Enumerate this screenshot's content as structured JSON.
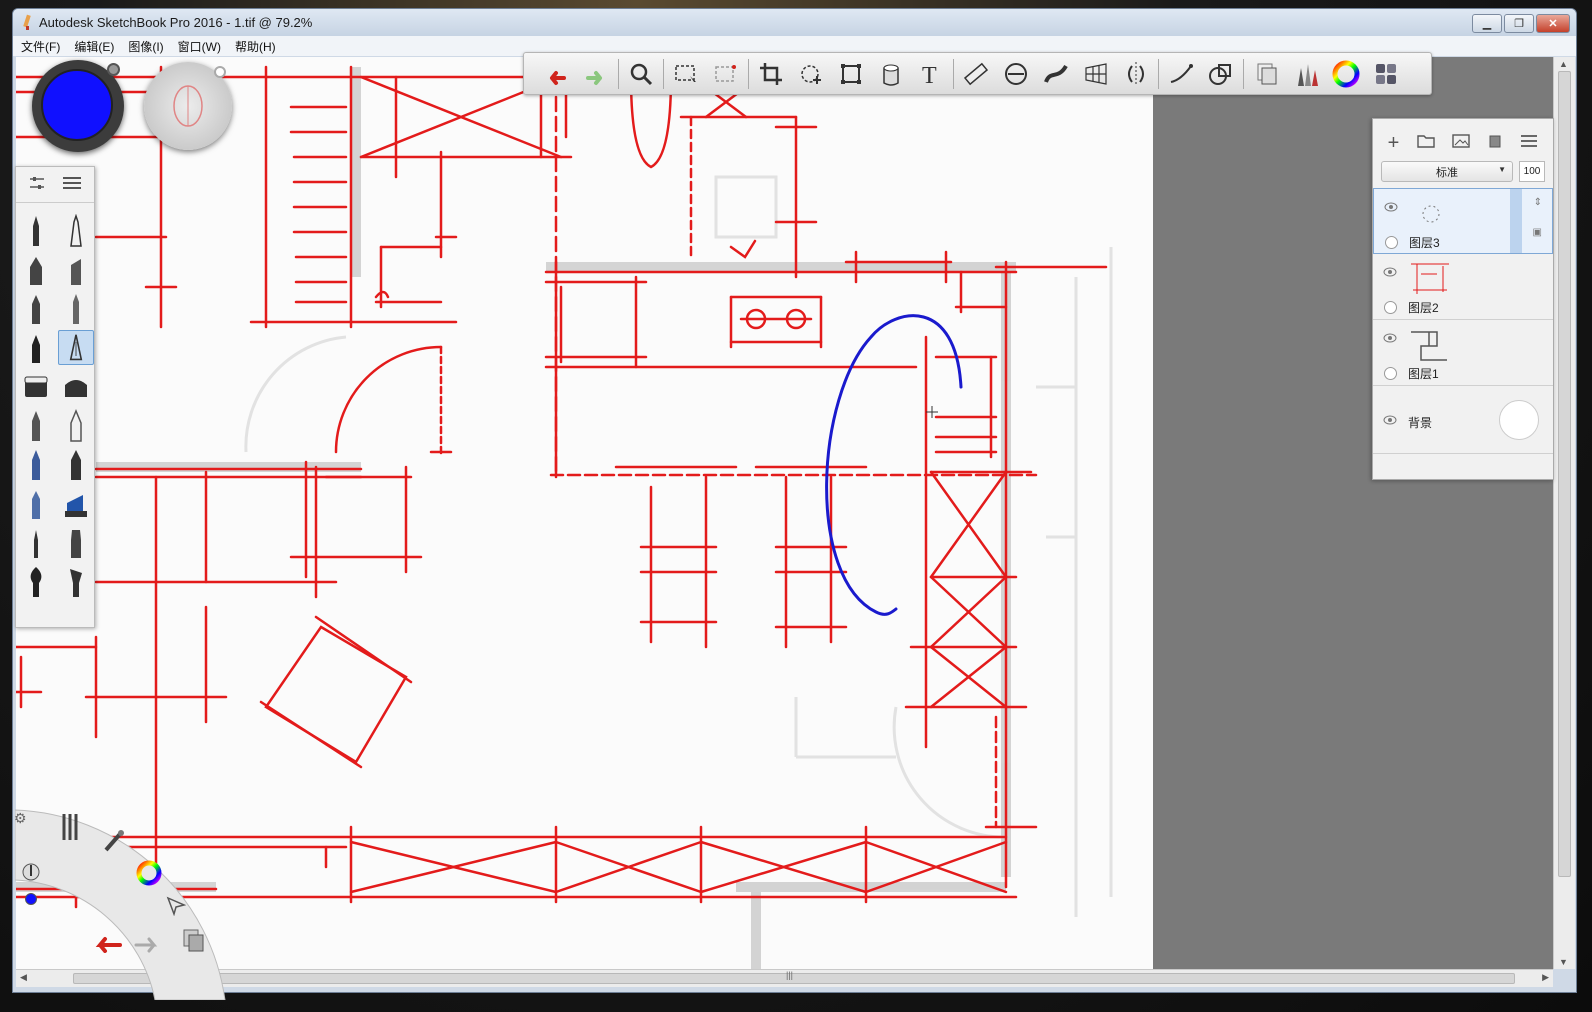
{
  "window": {
    "title": "Autodesk SketchBook Pro 2016 - 1.tif @ 79.2%",
    "controls": [
      "minimize",
      "maximize",
      "close"
    ]
  },
  "menu": [
    "文件(F)",
    "编辑(E)",
    "图像(I)",
    "窗口(W)",
    "帮助(H)"
  ],
  "toolbar": {
    "tools": [
      "undo-icon",
      "redo-icon",
      "zoom-icon",
      "select-rect-icon",
      "select-lasso-icon",
      "crop-icon",
      "transform-move-icon",
      "distort-icon",
      "fill-bucket-icon",
      "text-icon",
      "ruler-icon",
      "ellipse-guide-icon",
      "french-curve-icon",
      "perspective-icon",
      "symmetry-icon",
      "stroke-line-icon",
      "shape-icon",
      "copybook-icon",
      "brush-library-icon",
      "color-wheel-icon",
      "interface-toggle-icon"
    ]
  },
  "color_puck": {
    "color": "#1010ff"
  },
  "layers": {
    "blend_mode": "标准",
    "opacity": "100",
    "items": [
      {
        "name": "图层3",
        "active": true
      },
      {
        "name": "图层2",
        "active": false
      },
      {
        "name": "图层1",
        "active": false
      },
      {
        "name": "背景",
        "active": false
      }
    ]
  },
  "colors": {
    "accent_red": "#e31b1b",
    "stroke_blue": "#1a1acd",
    "canvas_bg": "#7a7a7a"
  }
}
